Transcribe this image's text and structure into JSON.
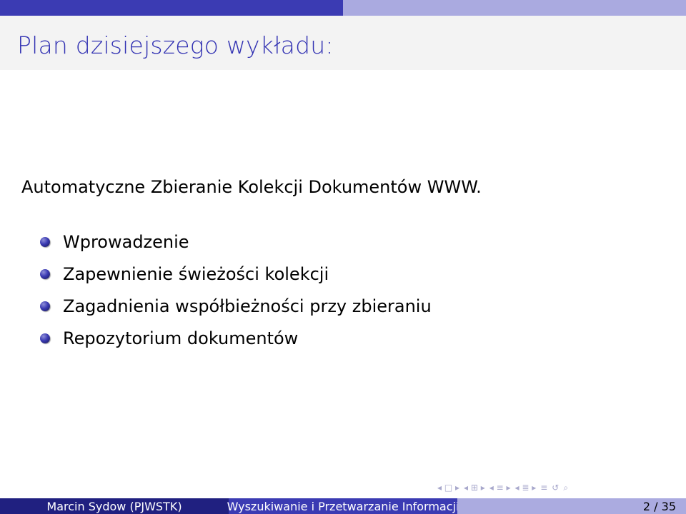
{
  "slide": {
    "title": "Plan dzisiejszego wykładu:",
    "intro": "Automatyczne Zbieranie Kolekcji Dokumentów WWW.",
    "bullets": [
      "Wprowadzenie",
      "Zapewnienie świeżości kolekcji",
      "Zagadnienia współbieżności przy zbieraniu",
      "Repozytorium dokumentów"
    ]
  },
  "footer": {
    "author": "Marcin Sydow  (PJWSTK)",
    "course": "Wyszukiwanie i Przetwarzanie Informacji",
    "page": "2 / 35"
  },
  "navigation": {
    "icons": [
      "nav-left-arrow-icon",
      "frame-icon",
      "nav-right-arrow-icon",
      "subsection-icon",
      "section-icon",
      "align-icon",
      "search-icon"
    ]
  },
  "colors": {
    "header_dark": "#3b3bb3",
    "header_light": "#aaaae0",
    "title": "#3333b3",
    "footer_left": "#202080",
    "footer_mid": "#3b3bb3",
    "footer_right": "#ababe0"
  }
}
